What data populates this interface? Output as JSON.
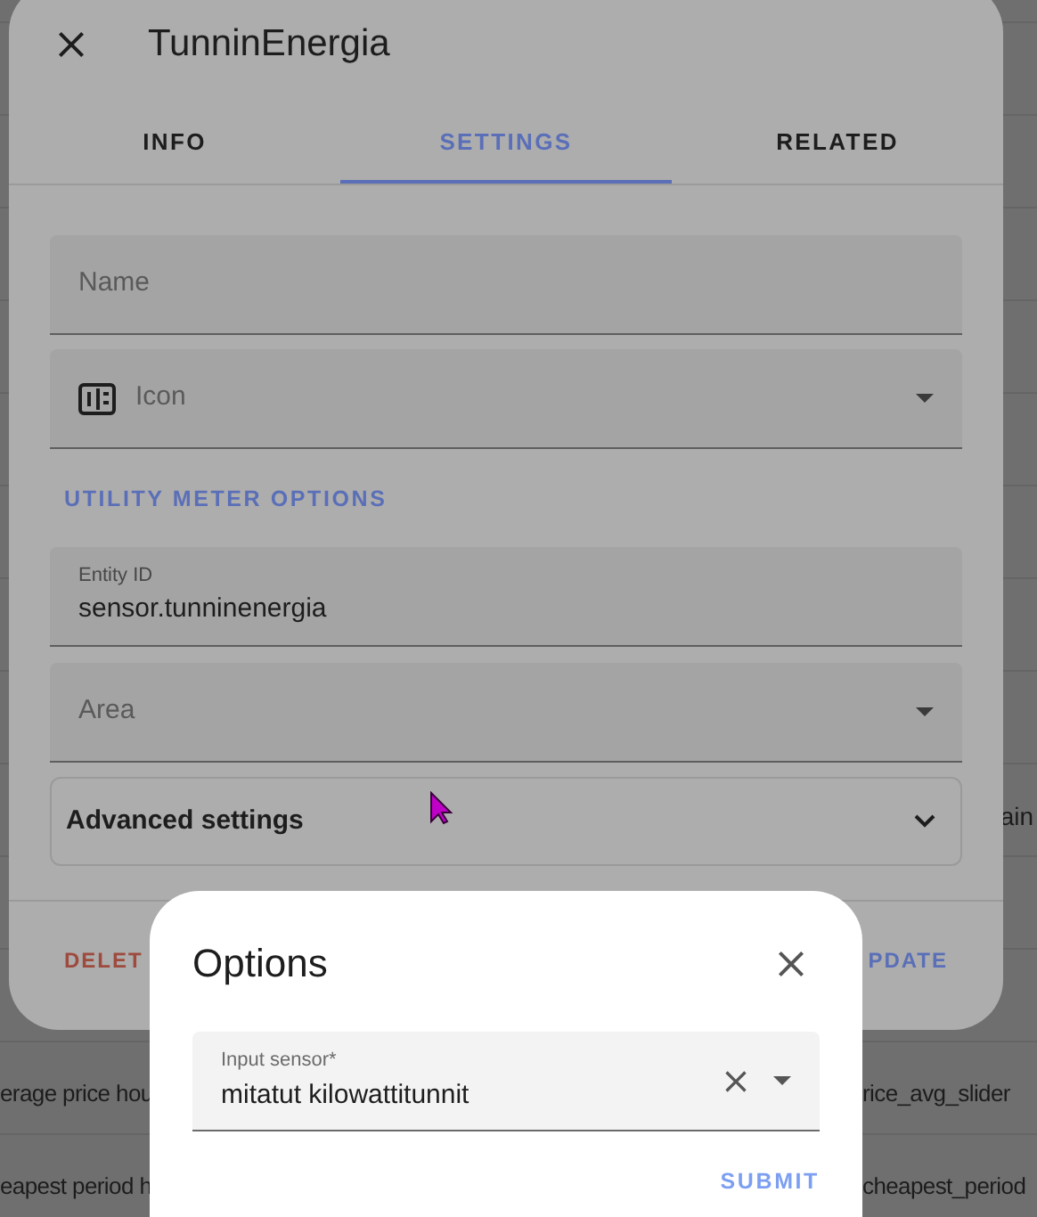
{
  "background": {
    "side_text": "ain",
    "rows": [
      {
        "left_text": "erage price hou",
        "right_text": "rice_avg_slider"
      },
      {
        "left_text": "eapest period h",
        "right_text": "cheapest_period"
      }
    ]
  },
  "entity_dialog": {
    "title": "TunninEnergia",
    "tabs": [
      {
        "label": "INFO",
        "selected": false
      },
      {
        "label": "SETTINGS",
        "selected": true
      },
      {
        "label": "RELATED",
        "selected": false
      }
    ],
    "name_field": {
      "placeholder": "Name"
    },
    "icon_field": {
      "placeholder": "Icon"
    },
    "section_link": "UTILITY METER OPTIONS",
    "entity_id_field": {
      "label": "Entity ID",
      "value": "sensor.tunninenergia"
    },
    "area_field": {
      "placeholder": "Area"
    },
    "advanced": {
      "label": "Advanced settings",
      "expanded": false
    },
    "delete_button": "DELET",
    "update_button": "PDATE"
  },
  "options_dialog": {
    "title": "Options",
    "input_field": {
      "label": "Input sensor*",
      "value": "mitatut kilowattitunnit"
    },
    "submit_button": "SUBMIT"
  }
}
